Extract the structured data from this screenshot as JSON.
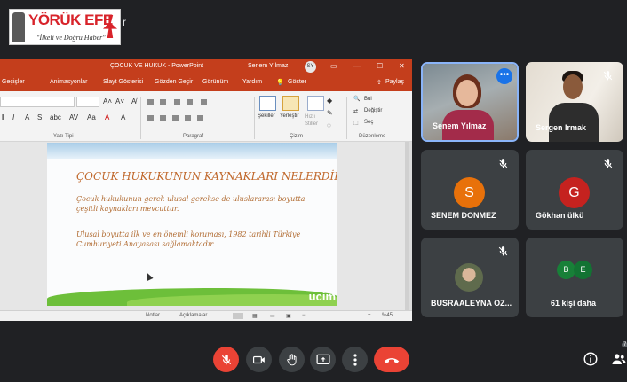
{
  "logo": {
    "brand": "YÖRÜK EFE",
    "tagline": "\"İlkeli ve Doğru Haber\""
  },
  "meeting": {
    "name_fragment": "r"
  },
  "powerpoint": {
    "title": "ÇOCUK VE HUKUK - PowerPoint",
    "user": "Senem Yılmaz",
    "user_initials": "SY",
    "tabs": [
      "Geçişler",
      "Animasyonlar",
      "Slayt Gösterisi",
      "Gözden Geçir",
      "Görünüm",
      "Yardım",
      "Göster",
      "Paylaş"
    ],
    "groups": {
      "font": "Yazı Tipi",
      "paragraph": "Paragraf",
      "drawing": "Çizim",
      "editing": "Düzenleme"
    },
    "ribbon": {
      "shapes": "Şekiller",
      "arrange": "Yerleştir",
      "quick_styles": "Hızlı Stiller",
      "find": "Bul",
      "replace": "Değiştir",
      "select": "Seç"
    },
    "slide": {
      "title": "ÇOCUK HUKUKUNUN KAYNAKLARI NELERDİR",
      "paragraph1": "Çocuk hukukunun gerek ulusal gerekse de uluslararası boyutta çeşitli kaynakları mevcuttur.",
      "paragraph2": "Ulusal boyutta ilk ve en önemli koruması, 1982 tarihli Türkiye Cumhuriyeti Anayasası sağlamaktadır.",
      "logo_text": "ucim"
    },
    "status": {
      "notes": "Notlar",
      "comments": "Açıklamalar",
      "zoom": "%45"
    }
  },
  "participants": [
    {
      "name": "Senem Yılmaz",
      "type": "video",
      "active": true
    },
    {
      "name": "Sergen Irmak",
      "type": "video",
      "muted": true
    },
    {
      "name": "SENEM DONMEZ",
      "initial": "S",
      "color": "#e8710a",
      "muted": true
    },
    {
      "name": "Gökhan ülkü",
      "initial": "G",
      "color": "#c5221f",
      "muted": true
    },
    {
      "name": "BUSRAALEYNA OZ...",
      "type": "photo",
      "muted": true
    },
    {
      "name": "61 kişi daha",
      "initials": [
        "B",
        "E"
      ],
      "colors": [
        "#188038",
        "#137333"
      ]
    }
  ],
  "controls": [
    {
      "name": "microphone-off",
      "color": "#ea4335"
    },
    {
      "name": "camera"
    },
    {
      "name": "raise-hand"
    },
    {
      "name": "present-now"
    },
    {
      "name": "more-options"
    },
    {
      "name": "leave-call",
      "color": "#ea4335"
    }
  ],
  "badge": "7"
}
